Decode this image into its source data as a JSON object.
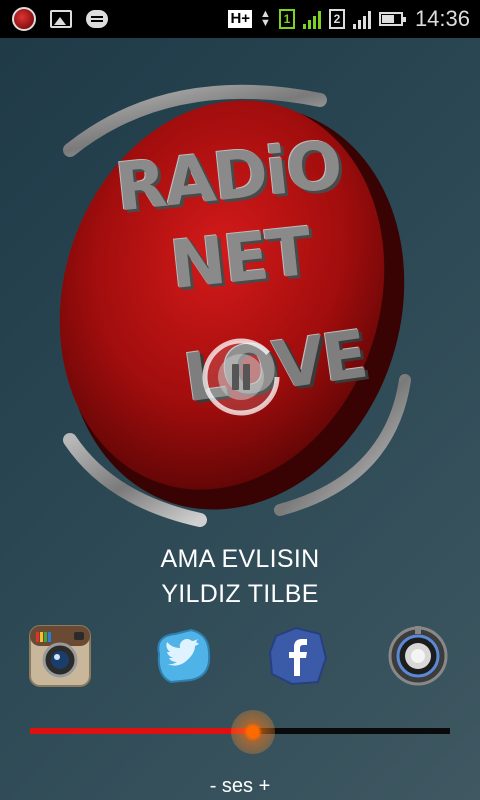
{
  "status_bar": {
    "network_type": "H+",
    "sim1": "1",
    "sim2": "2",
    "time": "14:36"
  },
  "logo": {
    "line1": "RADiO",
    "line2": "NET",
    "line3": "LOVE"
  },
  "now_playing": {
    "title": "AMA EVLISIN",
    "artist": "YILDIZ TILBE"
  },
  "social": [
    {
      "name": "instagram",
      "icon": "instagram-icon"
    },
    {
      "name": "twitter",
      "icon": "twitter-icon"
    },
    {
      "name": "facebook",
      "icon": "facebook-icon"
    },
    {
      "name": "power",
      "icon": "power-icon"
    }
  ],
  "volume": {
    "label": "- ses +",
    "level": 0.53
  },
  "colors": {
    "accent": "#e01010",
    "thumb": "#ff6a00",
    "sim1": "#7ed321"
  }
}
